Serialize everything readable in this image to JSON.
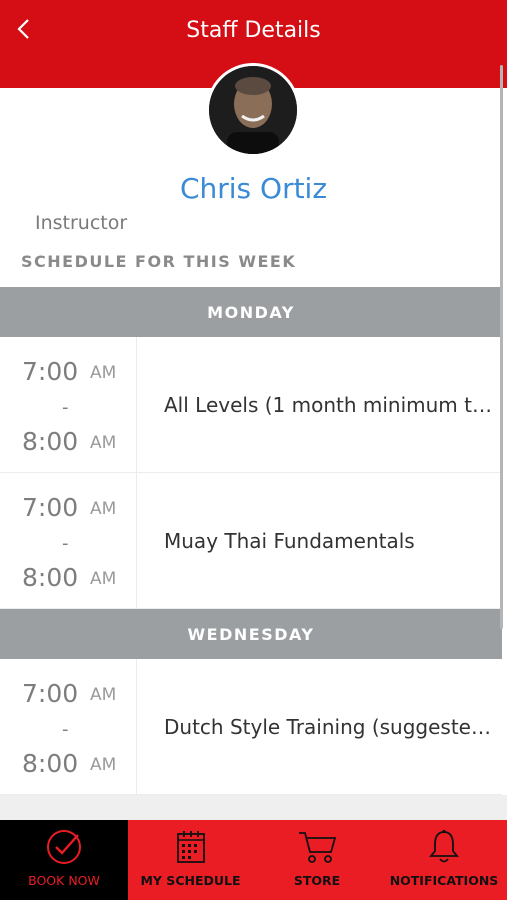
{
  "header": {
    "title": "Staff Details"
  },
  "staff": {
    "name": "Chris Ortiz",
    "role": "Instructor"
  },
  "schedule_title": "SCHEDULE FOR THIS WEEK",
  "days": [
    {
      "day": "MONDAY",
      "classes": [
        {
          "start": "7:00",
          "start_ampm": "AM",
          "sep": "-",
          "end": "8:00",
          "end_ampm": "AM",
          "name": "All Levels (1 month minimum tr..."
        },
        {
          "start": "7:00",
          "start_ampm": "AM",
          "sep": "-",
          "end": "8:00",
          "end_ampm": "AM",
          "name": "Muay Thai Fundamentals"
        }
      ]
    },
    {
      "day": "WEDNESDAY",
      "classes": [
        {
          "start": "7:00",
          "start_ampm": "AM",
          "sep": "-",
          "end": "8:00",
          "end_ampm": "AM",
          "name": "Dutch Style Training (suggested..."
        }
      ]
    }
  ],
  "tabs": [
    {
      "label": "BOOK NOW",
      "icon": "check-circle-icon",
      "active": true
    },
    {
      "label": "MY SCHEDULE",
      "icon": "calendar-icon",
      "active": false
    },
    {
      "label": "STORE",
      "icon": "cart-icon",
      "active": false
    },
    {
      "label": "NOTIFICATIONS",
      "icon": "bell-icon",
      "active": false
    }
  ],
  "colors": {
    "header": "#d40e14",
    "tabbar": "#ea1c24",
    "active_tab": "#000000",
    "name": "#3b8ad6",
    "day_header": "#9b9fa2"
  }
}
